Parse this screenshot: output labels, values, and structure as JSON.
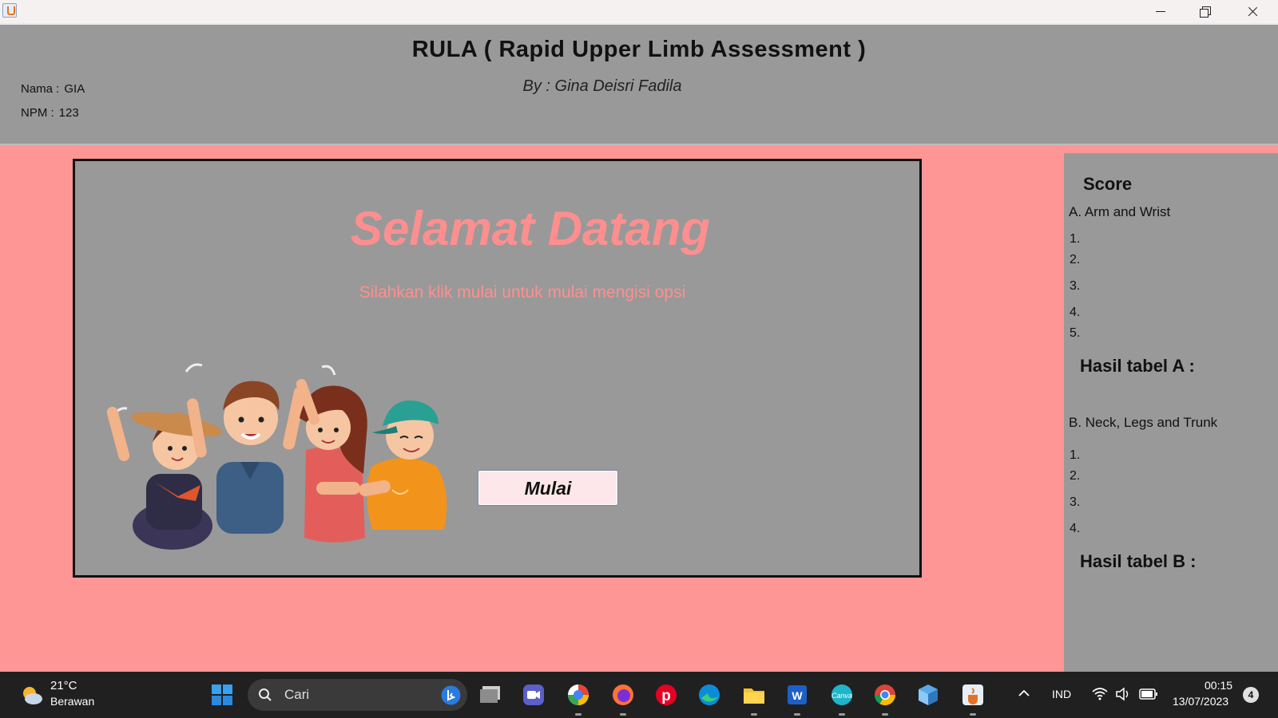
{
  "header": {
    "title": "RULA (  Rapid Upper Limb Assessment )",
    "byline": "By : Gina Deisri Fadila",
    "nama_label": "Nama :",
    "nama_value": "GIA",
    "npm_label": "NPM :",
    "npm_value": "123"
  },
  "welcome": {
    "title": "Selamat Datang",
    "subtitle": "Silahkan klik mulai untuk mulai mengisi opsi",
    "start_button": "Mulai"
  },
  "score": {
    "title": "Score",
    "section_a": "A. Arm and Wrist",
    "section_a_items": [
      "1.",
      "2.",
      "3.",
      "4.",
      "5."
    ],
    "result_a": "Hasil tabel A :",
    "section_b": "B. Neck, Legs and Trunk",
    "section_b_items": [
      "1.",
      "2.",
      "3.",
      "4."
    ],
    "result_b": "Hasil tabel B :"
  },
  "taskbar": {
    "weather_temp": "21°C",
    "weather_desc": "Berawan",
    "search_placeholder": "Cari",
    "language": "IND",
    "time": "00:15",
    "date": "13/07/2023",
    "notifications": "4",
    "apps": [
      "windows-start-icon",
      "task-view-icon",
      "teams-icon",
      "google-one-icon",
      "firefox-icon",
      "pinterest-icon",
      "edge-icon",
      "file-explorer-icon",
      "word-icon",
      "canva-icon",
      "chrome-icon",
      "3d-box-icon",
      "java-icon"
    ]
  },
  "colors": {
    "background": "#ff9696",
    "panel": "#999999",
    "accent_text": "#ff8f8f",
    "button": "#fde7ea"
  }
}
